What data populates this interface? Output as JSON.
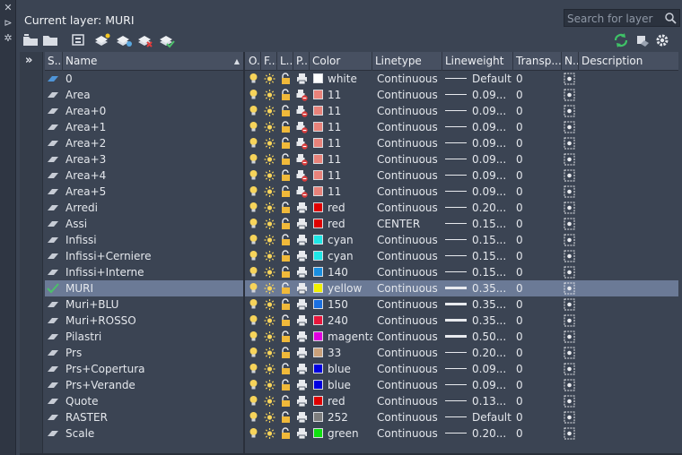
{
  "window": {
    "title": "Current layer: MURI",
    "search_placeholder": "Search for layer"
  },
  "side_strip": [
    "close-icon",
    "pin-icon",
    "settings-icon"
  ],
  "toolbar": {
    "left": [
      "new-layer-state-icon",
      "layer-states-manager-icon",
      "new-property-filter-icon",
      "new-layer-icon",
      "new-layer-vp-frozen-icon",
      "delete-layer-icon",
      "set-current-icon"
    ],
    "right": [
      "refresh-icon",
      "merge-icon",
      "settings-gear-icon"
    ]
  },
  "filter_pane": {
    "toggle_label": "»"
  },
  "columns": [
    "S..",
    "Name",
    "O..",
    "F...",
    "L...",
    "P...",
    "Color",
    "Linetype",
    "Lineweight",
    "Transp...",
    "N..",
    "Description"
  ],
  "colors": {
    "selected_row": "#6b7a96",
    "background": "#3b4453",
    "header": "#475061"
  },
  "layers": [
    {
      "name": "0",
      "color_name": "white",
      "color_hex": "#ffffff",
      "linetype": "Continuous",
      "lineweight": "Default",
      "transparency": "0",
      "plot": "printer",
      "current": false,
      "thick": false
    },
    {
      "name": "Area",
      "color_name": "11",
      "color_hex": "#e8827a",
      "linetype": "Continuous",
      "lineweight": "0.09...",
      "transparency": "0",
      "plot": "no-plot",
      "current": false,
      "thick": false
    },
    {
      "name": "Area+0",
      "color_name": "11",
      "color_hex": "#e8827a",
      "linetype": "Continuous",
      "lineweight": "0.09...",
      "transparency": "0",
      "plot": "no-plot",
      "current": false,
      "thick": false
    },
    {
      "name": "Area+1",
      "color_name": "11",
      "color_hex": "#e8827a",
      "linetype": "Continuous",
      "lineweight": "0.09...",
      "transparency": "0",
      "plot": "no-plot",
      "current": false,
      "thick": false
    },
    {
      "name": "Area+2",
      "color_name": "11",
      "color_hex": "#e8827a",
      "linetype": "Continuous",
      "lineweight": "0.09...",
      "transparency": "0",
      "plot": "no-plot",
      "current": false,
      "thick": false
    },
    {
      "name": "Area+3",
      "color_name": "11",
      "color_hex": "#e8827a",
      "linetype": "Continuous",
      "lineweight": "0.09...",
      "transparency": "0",
      "plot": "no-plot",
      "current": false,
      "thick": false
    },
    {
      "name": "Area+4",
      "color_name": "11",
      "color_hex": "#e8827a",
      "linetype": "Continuous",
      "lineweight": "0.09...",
      "transparency": "0",
      "plot": "no-plot",
      "current": false,
      "thick": false
    },
    {
      "name": "Area+5",
      "color_name": "11",
      "color_hex": "#e8827a",
      "linetype": "Continuous",
      "lineweight": "0.09...",
      "transparency": "0",
      "plot": "no-plot",
      "current": false,
      "thick": false
    },
    {
      "name": "Arredi",
      "color_name": "red",
      "color_hex": "#e00000",
      "linetype": "Continuous",
      "lineweight": "0.20...",
      "transparency": "0",
      "plot": "printer",
      "current": false,
      "thick": false
    },
    {
      "name": "Assi",
      "color_name": "red",
      "color_hex": "#e00000",
      "linetype": "CENTER",
      "lineweight": "0.15...",
      "transparency": "0",
      "plot": "printer",
      "current": false,
      "thick": false
    },
    {
      "name": "Infissi",
      "color_name": "cyan",
      "color_hex": "#1ee6e6",
      "linetype": "Continuous",
      "lineweight": "0.15...",
      "transparency": "0",
      "plot": "printer",
      "current": false,
      "thick": false
    },
    {
      "name": "Infissi+Cerniere",
      "color_name": "cyan",
      "color_hex": "#1ee6e6",
      "linetype": "Continuous",
      "lineweight": "0.15...",
      "transparency": "0",
      "plot": "printer",
      "current": false,
      "thick": false
    },
    {
      "name": "Infissi+Interne",
      "color_name": "140",
      "color_hex": "#1a8fe0",
      "linetype": "Continuous",
      "lineweight": "0.15...",
      "transparency": "0",
      "plot": "printer",
      "current": false,
      "thick": false
    },
    {
      "name": "MURI",
      "color_name": "yellow",
      "color_hex": "#f0f000",
      "linetype": "Continuous",
      "lineweight": "0.35...",
      "transparency": "0",
      "plot": "printer",
      "current": true,
      "thick": true
    },
    {
      "name": "Muri+BLU",
      "color_name": "150",
      "color_hex": "#1a6fe0",
      "linetype": "Continuous",
      "lineweight": "0.35...",
      "transparency": "0",
      "plot": "printer",
      "current": false,
      "thick": true
    },
    {
      "name": "Muri+ROSSO",
      "color_name": "240",
      "color_hex": "#e8163c",
      "linetype": "Continuous",
      "lineweight": "0.35...",
      "transparency": "0",
      "plot": "printer",
      "current": false,
      "thick": true
    },
    {
      "name": "Pilastri",
      "color_name": "magenta",
      "color_hex": "#e000e0",
      "linetype": "Continuous",
      "lineweight": "0.50...",
      "transparency": "0",
      "plot": "printer",
      "current": false,
      "thick": true
    },
    {
      "name": "Prs",
      "color_name": "33",
      "color_hex": "#c9a07a",
      "linetype": "Continuous",
      "lineweight": "0.20...",
      "transparency": "0",
      "plot": "printer",
      "current": false,
      "thick": false
    },
    {
      "name": "Prs+Copertura",
      "color_name": "blue",
      "color_hex": "#0000e0",
      "linetype": "Continuous",
      "lineweight": "0.09...",
      "transparency": "0",
      "plot": "printer",
      "current": false,
      "thick": false
    },
    {
      "name": "Prs+Verande",
      "color_name": "blue",
      "color_hex": "#0000e0",
      "linetype": "Continuous",
      "lineweight": "0.09...",
      "transparency": "0",
      "plot": "printer",
      "current": false,
      "thick": false
    },
    {
      "name": "Quote",
      "color_name": "red",
      "color_hex": "#e00000",
      "linetype": "Continuous",
      "lineweight": "0.13...",
      "transparency": "0",
      "plot": "printer",
      "current": false,
      "thick": false
    },
    {
      "name": "RASTER",
      "color_name": "252",
      "color_hex": "#7d7d7d",
      "linetype": "Continuous",
      "lineweight": "Default",
      "transparency": "0",
      "plot": "printer",
      "current": false,
      "thick": false
    },
    {
      "name": "Scale",
      "color_name": "green",
      "color_hex": "#10e010",
      "linetype": "Continuous",
      "lineweight": "0.20...",
      "transparency": "0",
      "plot": "printer",
      "current": false,
      "thick": false
    }
  ]
}
